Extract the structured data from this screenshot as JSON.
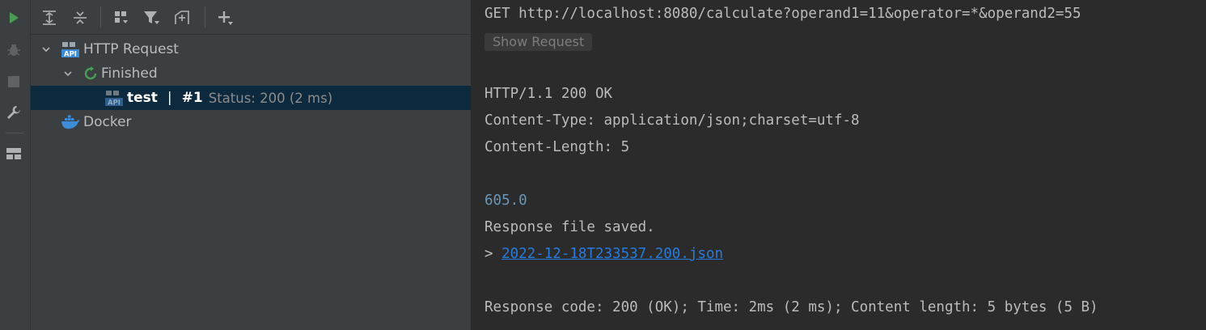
{
  "left_strip": {
    "icons": [
      "run-icon",
      "debug-icon",
      "stop-icon",
      "wrench-icon",
      "layout-icon"
    ]
  },
  "toolbar": {
    "icons": [
      "expand-all-icon",
      "collapse-all-icon",
      "group-icon",
      "filter-icon",
      "compose-icon",
      "add-icon"
    ]
  },
  "tree": {
    "http_request_label": "HTTP Request",
    "finished_label": "Finished",
    "test_name": "test",
    "test_sep": "|",
    "test_run": "#1",
    "test_status": "Status: 200 (2 ms)",
    "docker_label": "Docker"
  },
  "console": {
    "request_line": "GET http://localhost:8080/calculate?operand1=11&operator=*&operand2=55",
    "show_request_label": "Show Request",
    "status_line": "HTTP/1.1 200 OK",
    "content_type": "Content-Type: application/json;charset=utf-8",
    "content_length": "Content-Length: 5",
    "body_value": "605.0",
    "saved_text": "Response file saved.",
    "file_prefix": "> ",
    "file_link": "2022-12-18T233537.200.json",
    "summary": "Response code: 200 (OK); Time: 2ms (2 ms); Content length: 5 bytes (5 B)"
  },
  "colors": {
    "accent_green": "#499c54",
    "selection_bg": "#0d293e",
    "number_blue": "#6897bb",
    "link_blue": "#287bde",
    "docker_blue": "#3d8dd6"
  }
}
